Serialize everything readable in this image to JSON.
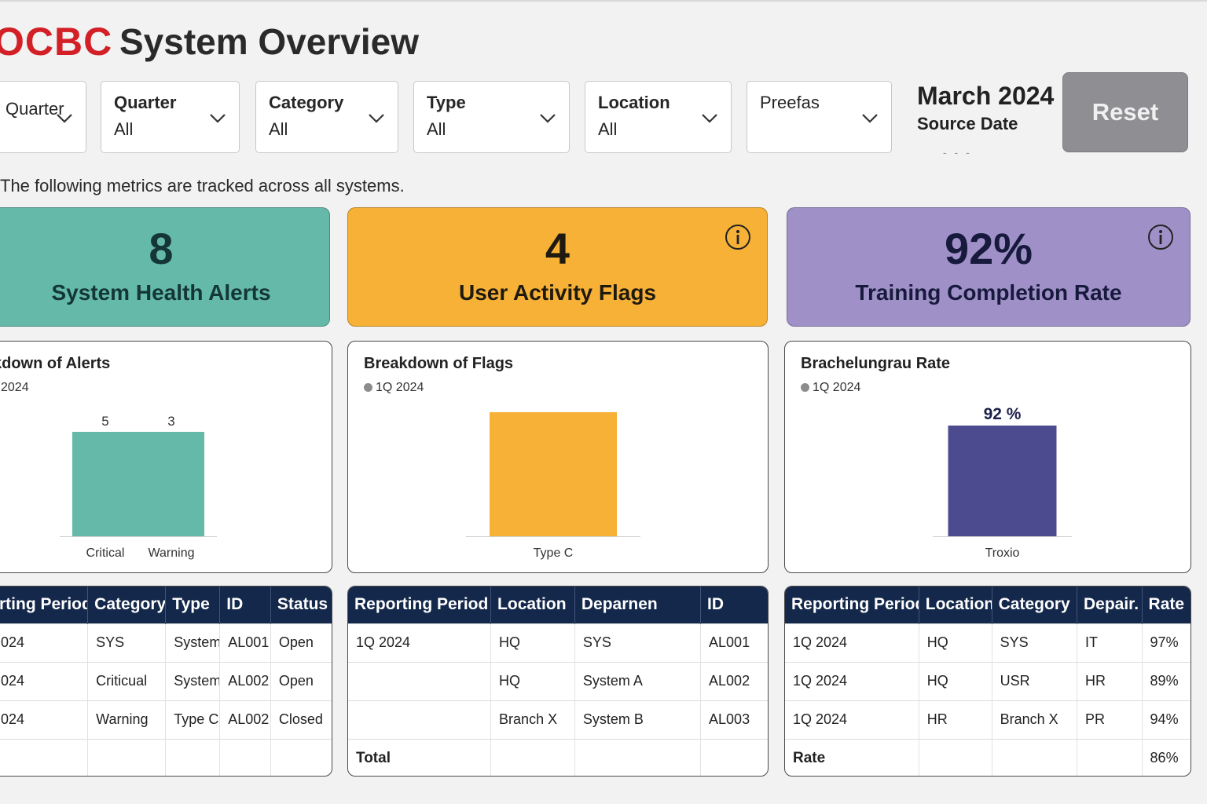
{
  "header": {
    "logo_text": "OCBC",
    "title": "System Overview",
    "subtitle": "The following metrics are tracked across all systems."
  },
  "filters": [
    {
      "label": "",
      "value": "Quarter"
    },
    {
      "label": "Quarter",
      "value": "All"
    },
    {
      "label": "Category",
      "value": "All"
    },
    {
      "label": "Type",
      "value": "All"
    },
    {
      "label": "Location",
      "value": "All"
    },
    {
      "label": "Preefas",
      "value": ""
    }
  ],
  "source": {
    "date": "March 2024",
    "label": "Source Date",
    "dash": "- - -"
  },
  "reset_label": "Reset",
  "kpis": [
    {
      "value": "8",
      "label": "System Health Alerts",
      "color": "#64b9a8"
    },
    {
      "value": "4",
      "label": "User Activity Flags",
      "color": "#f6b136"
    },
    {
      "value": "92%",
      "label": "Training Completion Rate",
      "color": "#9f91c8"
    }
  ],
  "charts": [
    {
      "title": "kdown of Alerts",
      "legend": "2024",
      "chart_data": {
        "type": "bar",
        "categories": [
          "Critical",
          "Warning"
        ],
        "values": [
          5,
          3
        ],
        "data_labels": [
          "5",
          "3"
        ],
        "legend": [
          "1Q 2024"
        ],
        "color": "#64b9a8"
      }
    },
    {
      "title": "Breakdown of Flags",
      "legend": "1Q 2024",
      "chart_data": {
        "type": "bar",
        "categories": [
          "Type C"
        ],
        "values": [
          4
        ],
        "data_labels": [
          ""
        ],
        "legend": [
          "1Q 2024"
        ],
        "color": "#f6b136"
      }
    },
    {
      "title": "Brachelungrau Rate",
      "legend": "1Q 2024",
      "chart_data": {
        "type": "bar",
        "categories": [
          "Troxio"
        ],
        "values": [
          92
        ],
        "data_labels": [
          "92 %"
        ],
        "legend": [
          "1Q 2024"
        ],
        "color": "#4d4b8f"
      }
    }
  ],
  "tables": [
    {
      "columns": [
        "rting Period",
        "Category",
        "Type",
        "ID",
        "Status"
      ],
      "rows": [
        [
          "024",
          "SYS",
          "System",
          "AL001",
          "Open"
        ],
        [
          "024",
          "Criticual",
          "System",
          "AL002",
          "Open"
        ],
        [
          "024",
          "Warning",
          "Type C",
          "AL002",
          "Closed"
        ],
        [
          "",
          "",
          "",
          "",
          ""
        ]
      ]
    },
    {
      "columns": [
        "Reporting Period",
        "Location",
        "Deparnen",
        "ID"
      ],
      "rows": [
        [
          "1Q 2024",
          "HQ",
          "SYS",
          "AL001"
        ],
        [
          "",
          "HQ",
          "System A",
          "AL002"
        ],
        [
          "",
          "Branch X",
          "System B",
          "AL003"
        ],
        [
          "Total",
          "",
          "",
          ""
        ]
      ]
    },
    {
      "columns": [
        "Reporting Period",
        "Location",
        "Category",
        "Depair.",
        "Rate"
      ],
      "rows": [
        [
          "1Q 2024",
          "HQ",
          "SYS",
          "IT",
          "97%"
        ],
        [
          "1Q 2024",
          "HQ",
          "USR",
          "HR",
          "89%"
        ],
        [
          "1Q 2024",
          "HR",
          "Branch X",
          "PR",
          "94%"
        ],
        [
          "Rate",
          "",
          "",
          "",
          "86%"
        ]
      ]
    }
  ]
}
